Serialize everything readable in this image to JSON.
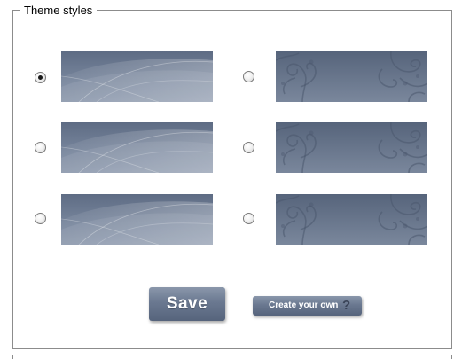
{
  "panel": {
    "legend": "Theme styles"
  },
  "themes": [
    {
      "style": "waves",
      "selected": true
    },
    {
      "style": "floral",
      "selected": false
    },
    {
      "style": "waves",
      "selected": false
    },
    {
      "style": "floral",
      "selected": false
    },
    {
      "style": "waves",
      "selected": false
    },
    {
      "style": "floral",
      "selected": false
    }
  ],
  "actions": {
    "save_label": "Save",
    "create_label": "Create your own",
    "help_icon": "question-mark-icon",
    "help_glyph": "?"
  },
  "colors": {
    "theme_base": "#6f7e95",
    "button_top": "#8a97ab",
    "button_bottom": "#56647c"
  }
}
